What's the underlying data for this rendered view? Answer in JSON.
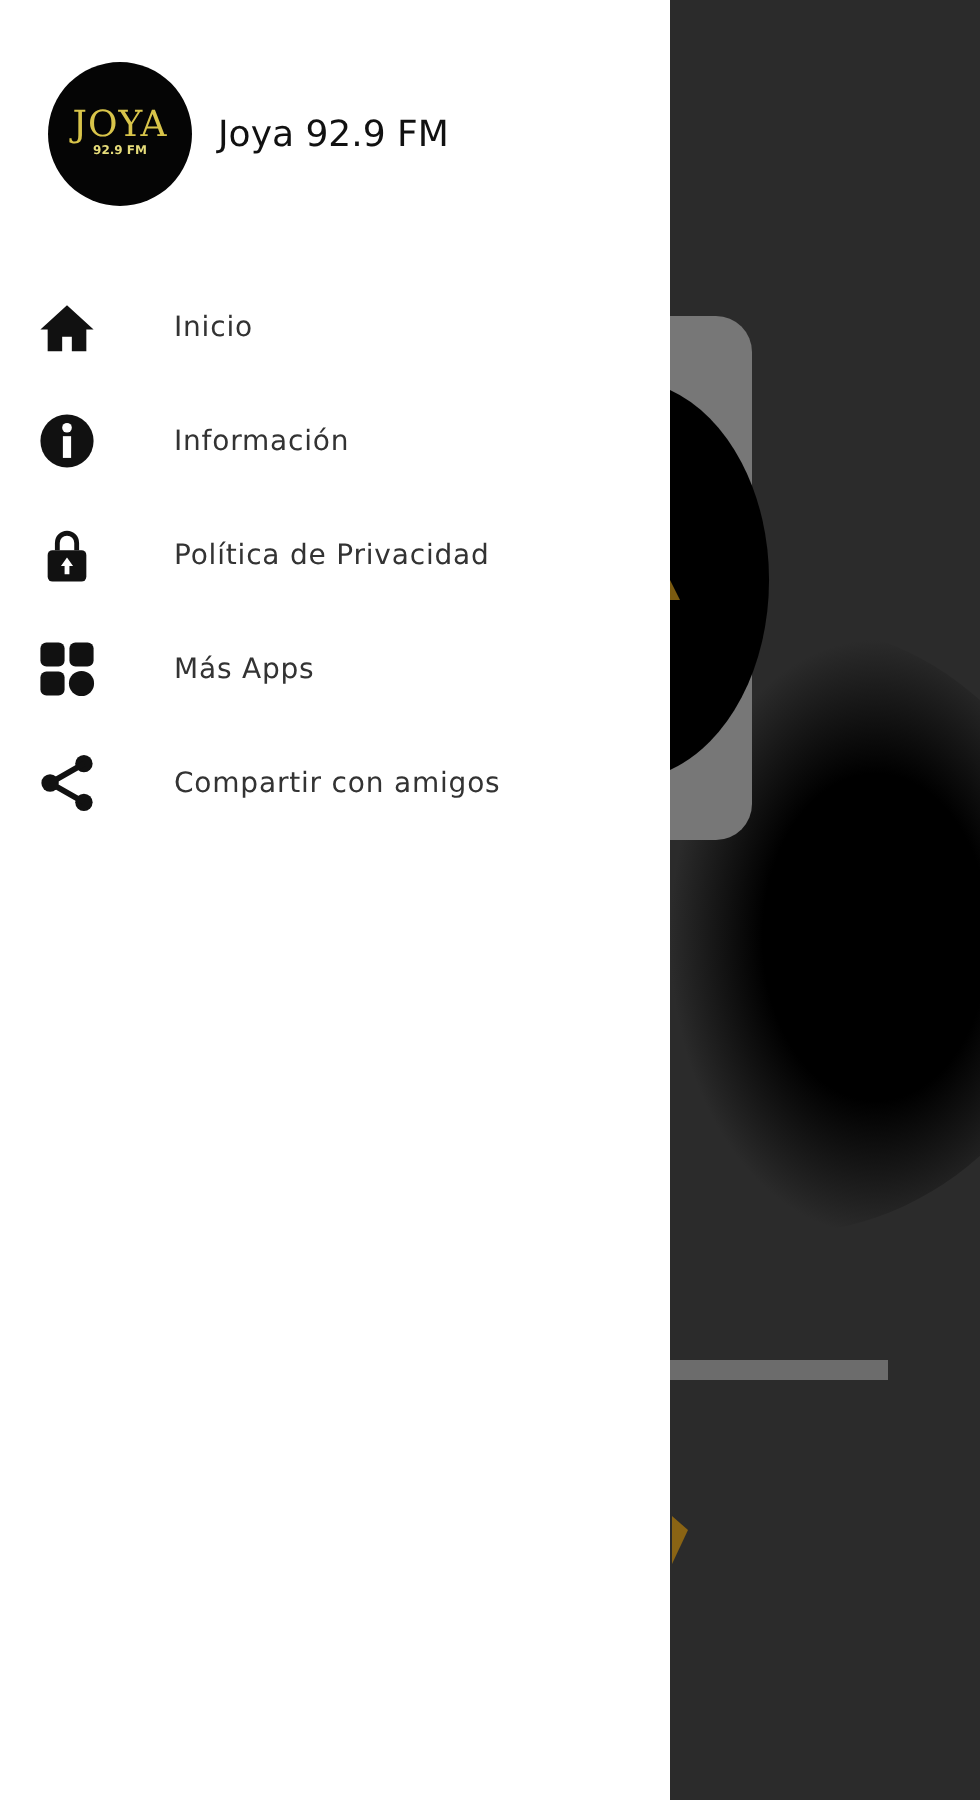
{
  "drawer": {
    "logo": {
      "wordmark": "JOYA",
      "frequency": "92.9 FM"
    },
    "title": "Joya 92.9 FM",
    "items": [
      {
        "kind": "home",
        "label": "Inicio"
      },
      {
        "kind": "info",
        "label": "Información"
      },
      {
        "kind": "lock",
        "label": "Política de Privacidad"
      },
      {
        "kind": "apps",
        "label": "Más Apps"
      },
      {
        "kind": "share",
        "label": "Compartir con amigos"
      }
    ]
  }
}
